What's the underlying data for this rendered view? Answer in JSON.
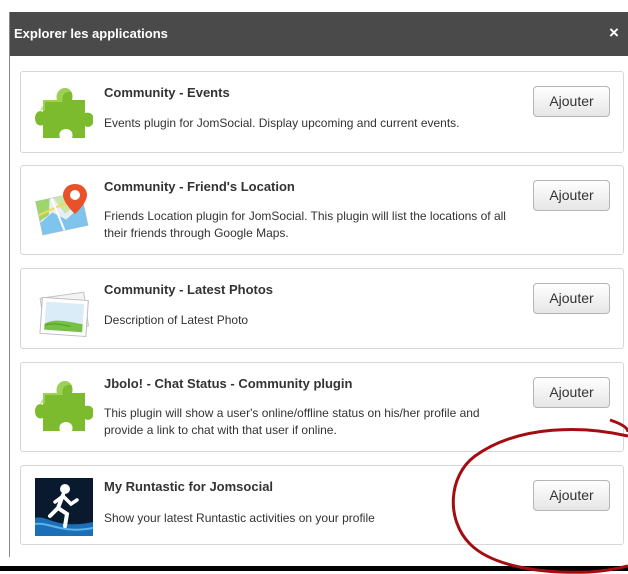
{
  "dialog": {
    "title": "Explorer les applications",
    "close_label": "×"
  },
  "apps": [
    {
      "title": "Community - Events",
      "description": "Events plugin for JomSocial. Display upcoming and current events.",
      "button_label": "Ajouter",
      "icon": "puzzle-icon"
    },
    {
      "title": "Community - Friend's Location",
      "description": "Friends Location plugin for JomSocial. This plugin will list the locations of all their friends through Google Maps.",
      "button_label": "Ajouter",
      "icon": "map-pin-icon"
    },
    {
      "title": "Community - Latest Photos",
      "description": "Description of Latest Photo",
      "button_label": "Ajouter",
      "icon": "photos-icon"
    },
    {
      "title": "Jbolo! - Chat Status - Community plugin",
      "description": "This plugin will show a user's online/offline status on his/her profile and provide a link to chat with that user if online.",
      "button_label": "Ajouter",
      "icon": "puzzle-icon"
    },
    {
      "title": "My Runtastic for Jomsocial",
      "description": "Show your latest Runtastic activities on your profile",
      "button_label": "Ajouter",
      "icon": "runner-icon"
    }
  ],
  "colors": {
    "titlebar": "#4a4a4a",
    "annotation_circle": "#a30d12",
    "puzzle_green": "#7dbb2e"
  }
}
